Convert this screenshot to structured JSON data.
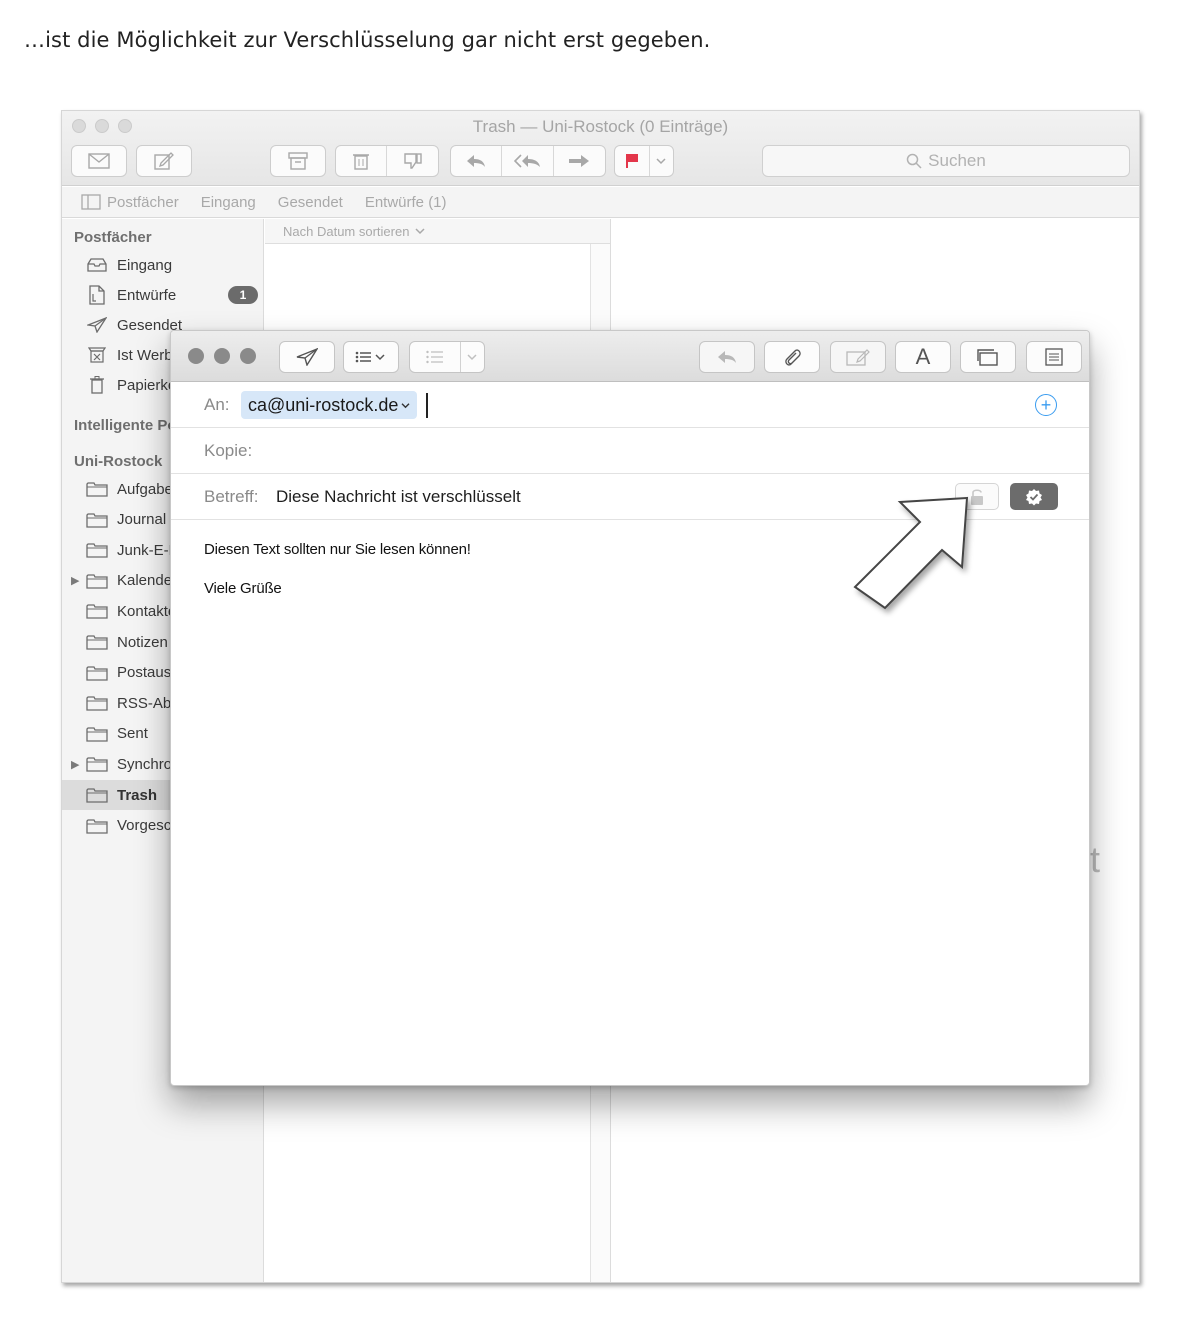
{
  "document": {
    "heading": "…ist die Möglichkeit zur Verschlüsselung gar nicht erst gegeben."
  },
  "mail_window": {
    "title": "Trash — Uni-Rostock (0 Einträge)",
    "search": {
      "placeholder": "Suchen"
    },
    "favorites_bar": {
      "mailboxes": "Postfächer",
      "inbox": "Eingang",
      "sent": "Gesendet",
      "drafts": "Entwürfe (1)"
    },
    "sidebar": {
      "section_mailboxes": "Postfächer",
      "mailboxes": [
        {
          "label": "Eingang",
          "icon": "inbox-icon"
        },
        {
          "label": "Entwürfe",
          "icon": "draft-document-icon",
          "badge": "1"
        },
        {
          "label": "Gesendet",
          "icon": "paper-plane-icon"
        },
        {
          "label": "Ist Werbung",
          "icon": "junk-icon"
        },
        {
          "label": "Papierkorb",
          "icon": "trash-can-icon"
        }
      ],
      "section_smart": "Intelligente Postfächer",
      "section_account": "Uni-Rostock",
      "folders": [
        {
          "label": "Aufgaben"
        },
        {
          "label": "Journal"
        },
        {
          "label": "Junk-E-Mail"
        },
        {
          "label": "Kalender",
          "expandable": true
        },
        {
          "label": "Kontakte"
        },
        {
          "label": "Notizen"
        },
        {
          "label": "Postausgang"
        },
        {
          "label": "RSS-Abonnements"
        },
        {
          "label": "Sent"
        },
        {
          "label": "Synchronisierungsprobleme",
          "expandable": true
        },
        {
          "label": "Trash",
          "selected": true
        },
        {
          "label": "Vorgeschlagene Kontakte"
        }
      ]
    },
    "message_list": {
      "sort_label": "Nach Datum sortieren"
    },
    "viewer": {
      "empty_fragment": "lt"
    }
  },
  "compose": {
    "to_label": "An:",
    "to_recipient": "ca@uni-rostock.de",
    "cc_label": "Kopie:",
    "subject_label": "Betreff:",
    "subject_value": "Diese Nachricht ist verschlüsselt",
    "font_button": "A",
    "body_lines": [
      "Diesen Text sollten nur Sie lesen können!",
      "Viele Grüße"
    ],
    "colors": {
      "token_bg": "#d7e7f8",
      "add_icon": "#3a9cf0",
      "sign_button": "#6c6c6c"
    }
  }
}
